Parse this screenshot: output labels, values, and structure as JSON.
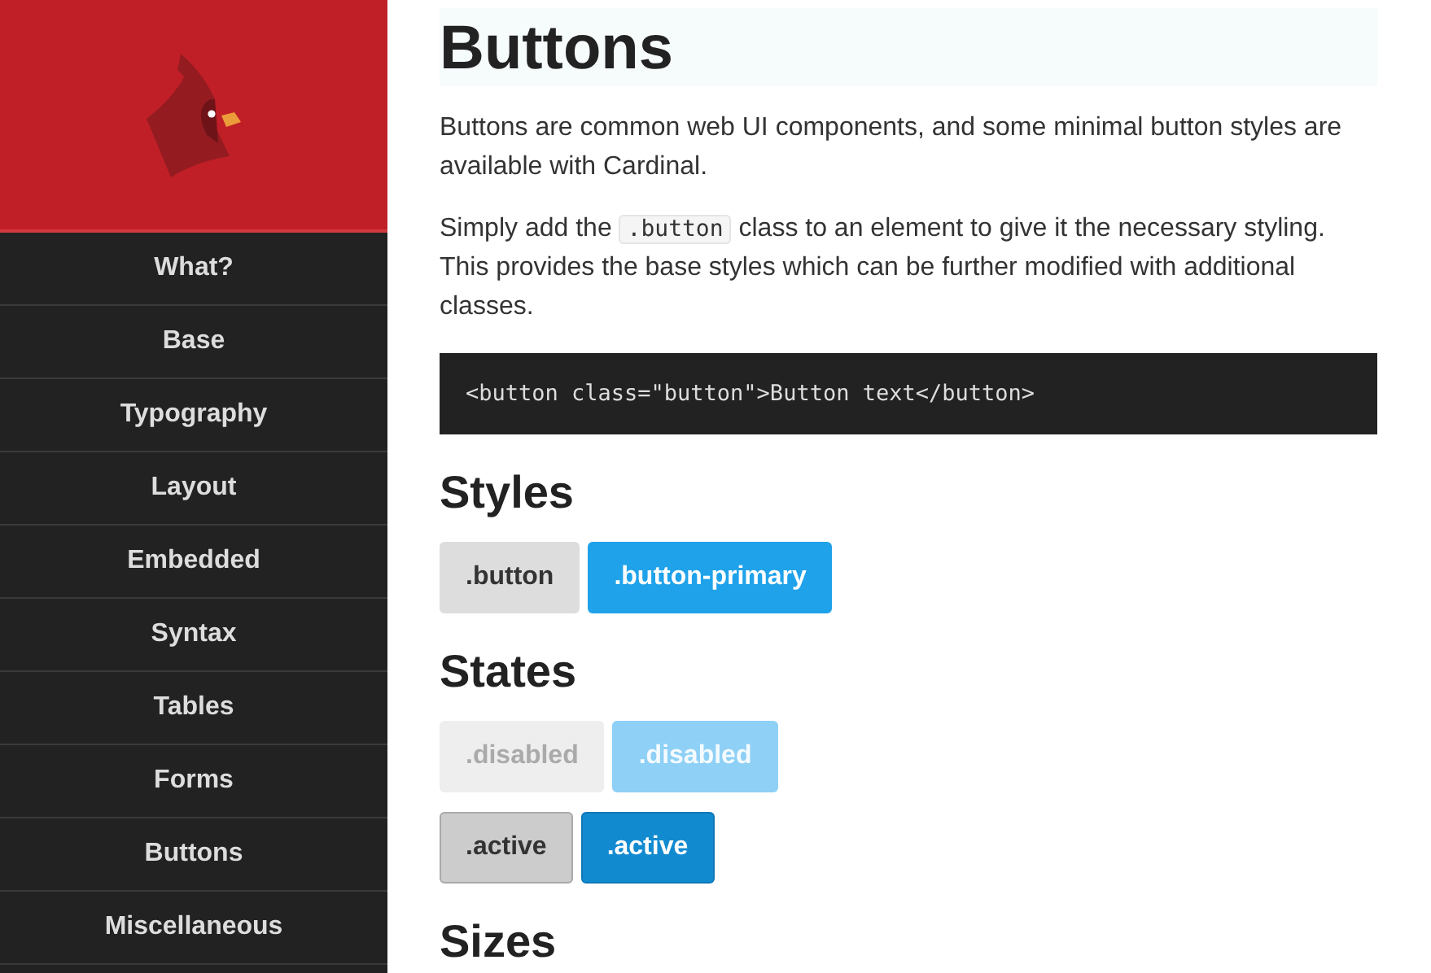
{
  "sidebar": {
    "items": [
      {
        "label": "What?"
      },
      {
        "label": "Base"
      },
      {
        "label": "Typography"
      },
      {
        "label": "Layout"
      },
      {
        "label": "Embedded"
      },
      {
        "label": "Syntax"
      },
      {
        "label": "Tables"
      },
      {
        "label": "Forms"
      },
      {
        "label": "Buttons"
      },
      {
        "label": "Miscellaneous"
      }
    ]
  },
  "content": [
    {
      "kind": "title",
      "text": "Buttons"
    },
    {
      "kind": "paragraph",
      "parts": [
        {
          "text": "Buttons are common web UI components, and some minimal button styles are available with Cardinal."
        }
      ]
    },
    {
      "kind": "paragraph",
      "parts": [
        {
          "text": "Simply add the "
        },
        {
          "code": ".button"
        },
        {
          "text": " class to an element to give it the necessary styling. This provides the base styles which can be further modified with additional classes."
        }
      ]
    },
    {
      "kind": "codeblock",
      "text": "<button class=\"button\">Button text</button>"
    },
    {
      "kind": "heading",
      "text": "Styles"
    },
    {
      "kind": "buttons",
      "buttons": [
        {
          "label": ".button",
          "kind": "default",
          "disabled": false,
          "active": false
        },
        {
          "label": ".button-primary",
          "kind": "primary",
          "disabled": false,
          "active": false
        }
      ]
    },
    {
      "kind": "heading",
      "text": "States"
    },
    {
      "kind": "buttons",
      "buttons": [
        {
          "label": ".disabled",
          "kind": "default",
          "disabled": true,
          "active": false
        },
        {
          "label": ".disabled",
          "kind": "primary",
          "disabled": true,
          "active": false
        }
      ]
    },
    {
      "kind": "buttons",
      "buttons": [
        {
          "label": ".active",
          "kind": "default",
          "disabled": false,
          "active": true
        },
        {
          "label": ".active",
          "kind": "primary",
          "disabled": false,
          "active": true
        }
      ]
    },
    {
      "kind": "heading",
      "text": "Sizes"
    }
  ]
}
